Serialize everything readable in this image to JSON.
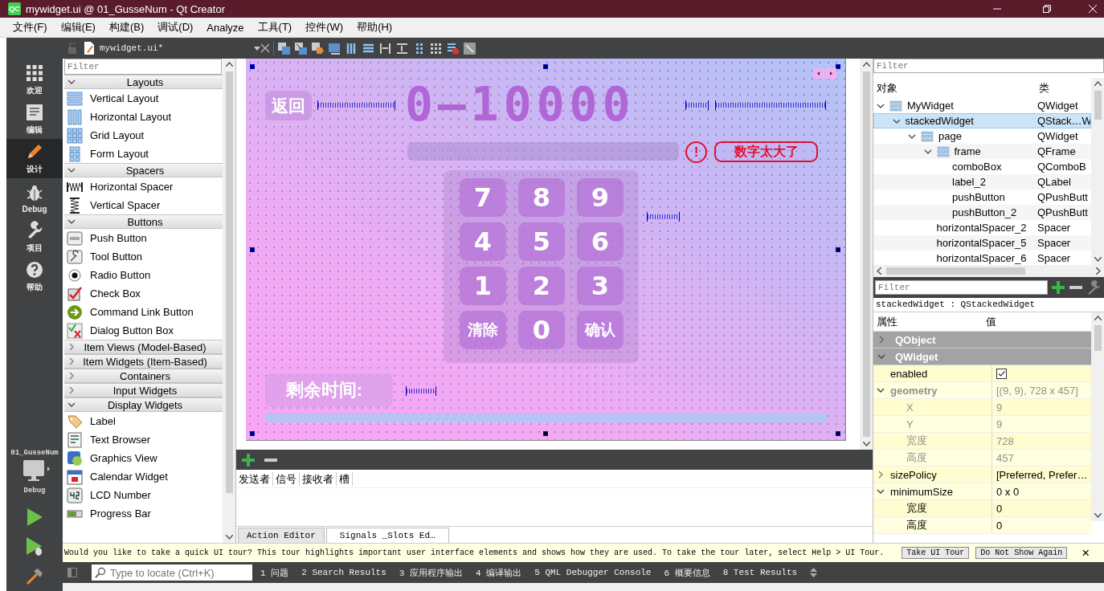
{
  "window": {
    "icon_text": "QC",
    "title": "mywidget.ui @ 01_GusseNum - Qt Creator"
  },
  "menu": [
    "文件(F)",
    "编辑(E)",
    "构建(B)",
    "调试(D)",
    "Analyze",
    "工具(T)",
    "控件(W)",
    "帮助(H)"
  ],
  "mode_bar": {
    "items": [
      {
        "label": "欢迎",
        "selected": false
      },
      {
        "label": "编辑",
        "selected": false
      },
      {
        "label": "设计",
        "selected": true
      },
      {
        "label": "Debug",
        "selected": false
      },
      {
        "label": "项目",
        "selected": false
      },
      {
        "label": "帮助",
        "selected": false
      }
    ],
    "project": "01_GusseNum",
    "build_config": "Debug"
  },
  "editor_toolbar": {
    "file": "mywidget.ui*"
  },
  "widget_box": {
    "filter_placeholder": "Filter",
    "categories": [
      {
        "name": "Layouts",
        "expanded": true,
        "items": [
          "Vertical Layout",
          "Horizontal Layout",
          "Grid Layout",
          "Form Layout"
        ]
      },
      {
        "name": "Spacers",
        "expanded": true,
        "items": [
          "Horizontal Spacer",
          "Vertical Spacer"
        ]
      },
      {
        "name": "Buttons",
        "expanded": true,
        "items": [
          "Push Button",
          "Tool Button",
          "Radio Button",
          "Check Box",
          "Command Link Button",
          "Dialog Button Box"
        ]
      },
      {
        "name": "Item Views (Model-Based)",
        "expanded": false
      },
      {
        "name": "Item Widgets (Item-Based)",
        "expanded": false
      },
      {
        "name": "Containers",
        "expanded": false
      },
      {
        "name": "Input Widgets",
        "expanded": false
      },
      {
        "name": "Display Widgets",
        "expanded": true,
        "items": [
          "Label",
          "Text Browser",
          "Graphics View",
          "Calendar Widget",
          "LCD Number",
          "Progress Bar"
        ]
      }
    ]
  },
  "form": {
    "back_button": "返回",
    "title": "0—10000",
    "warning_icon": "!",
    "warning": "数字太大了",
    "keys": [
      {
        "label": "7",
        "kind": "digit"
      },
      {
        "label": "8",
        "kind": "digit"
      },
      {
        "label": "9",
        "kind": "digit"
      },
      {
        "label": "4",
        "kind": "digit"
      },
      {
        "label": "5",
        "kind": "digit"
      },
      {
        "label": "6",
        "kind": "digit"
      },
      {
        "label": "1",
        "kind": "digit"
      },
      {
        "label": "2",
        "kind": "digit"
      },
      {
        "label": "3",
        "kind": "digit"
      },
      {
        "label": "清除",
        "kind": "action"
      },
      {
        "label": "0",
        "kind": "digit"
      },
      {
        "label": "确认",
        "kind": "action"
      }
    ],
    "time_label": "剩余时间:"
  },
  "signals_editor": {
    "columns": [
      "发送者",
      "信号",
      "接收者",
      "槽"
    ],
    "tabs": [
      {
        "label": "Action Editor",
        "selected": false
      },
      {
        "label": "Signals _Slots Ed…",
        "selected": true
      }
    ]
  },
  "object_inspector": {
    "filter_placeholder": "Filter",
    "columns": [
      "对象",
      "类"
    ],
    "tree": [
      {
        "name": "MyWidget",
        "class": "QWidget",
        "kind": "layout",
        "selected": false,
        "expanded": true,
        "children": [
          {
            "name": "stackedWidget",
            "class": "QStack…W",
            "kind": "widget",
            "selected": true,
            "expanded": true,
            "children": [
              {
                "name": "page",
                "class": "QWidget",
                "kind": "layout",
                "selected": false,
                "expanded": true,
                "children": [
                  {
                    "name": "frame",
                    "class": "QFrame",
                    "kind": "layout",
                    "selected": false,
                    "expanded": true,
                    "children": [
                      {
                        "name": "comboBox",
                        "class": "QComboB",
                        "kind": "widget",
                        "selected": false
                      },
                      {
                        "name": "label_2",
                        "class": "QLabel",
                        "kind": "widget",
                        "selected": false
                      },
                      {
                        "name": "pushButton",
                        "class": "QPushButt",
                        "kind": "widget",
                        "selected": false
                      },
                      {
                        "name": "pushButton_2",
                        "class": "QPushButt",
                        "kind": "widget",
                        "selected": false
                      }
                    ]
                  },
                  {
                    "name": "horizontalSpacer_2",
                    "class": "Spacer",
                    "kind": "widget",
                    "selected": false
                  },
                  {
                    "name": "horizontalSpacer_5",
                    "class": "Spacer",
                    "kind": "widget",
                    "selected": false
                  },
                  {
                    "name": "horizontalSpacer_6",
                    "class": "Spacer",
                    "kind": "widget",
                    "selected": false
                  }
                ]
              }
            ]
          }
        ]
      }
    ]
  },
  "property_editor": {
    "filter_placeholder": "Filter",
    "object_label": "stackedWidget : QStackedWidget",
    "columns": [
      "属性",
      "值"
    ],
    "groups": [
      {
        "name": "QObject",
        "expanded": false
      },
      {
        "name": "QWidget",
        "expanded": true,
        "properties": [
          {
            "name": "enabled",
            "kind": "checkbox",
            "checked": true,
            "disabled": false,
            "modified": false
          },
          {
            "name": "geometry",
            "kind": "text",
            "value": "[(9, 9), 728 x 457]",
            "disabled": true,
            "modified": true,
            "expanded": true,
            "children": [
              {
                "name": "X",
                "kind": "text",
                "value": "9",
                "disabled": true,
                "modified": false
              },
              {
                "name": "Y",
                "kind": "text",
                "value": "9",
                "disabled": true,
                "modified": false
              },
              {
                "name": "宽度",
                "kind": "text",
                "value": "728",
                "disabled": true,
                "modified": false
              },
              {
                "name": "高度",
                "kind": "text",
                "value": "457",
                "disabled": true,
                "modified": false
              }
            ]
          },
          {
            "name": "sizePolicy",
            "kind": "text",
            "value": "[Preferred, Prefer…",
            "disabled": false,
            "modified": false,
            "expanded": false
          },
          {
            "name": "minimumSize",
            "kind": "text",
            "value": "0 x 0",
            "disabled": false,
            "modified": false,
            "expanded": true,
            "children": [
              {
                "name": "宽度",
                "kind": "text",
                "value": "0",
                "disabled": false,
                "modified": false
              },
              {
                "name": "高度",
                "kind": "text",
                "value": "0",
                "disabled": false,
                "modified": false
              }
            ]
          }
        ]
      }
    ]
  },
  "tour_bar": {
    "message": "Would you like to take a quick UI tour? This tour highlights important user interface elements and shows how they are used. To take the tour later, select Help > UI Tour.",
    "buttons": [
      "Take UI Tour",
      "Do Not Show Again"
    ],
    "close": "×"
  },
  "status_bar": {
    "locate_placeholder": "Type to locate (Ctrl+K)",
    "panes": [
      "1 问题",
      "2 Search Results",
      "3 应用程序输出",
      "4 编译输出",
      "5 QML Debugger Console",
      "6 概要信息",
      "8 Test Results"
    ]
  }
}
